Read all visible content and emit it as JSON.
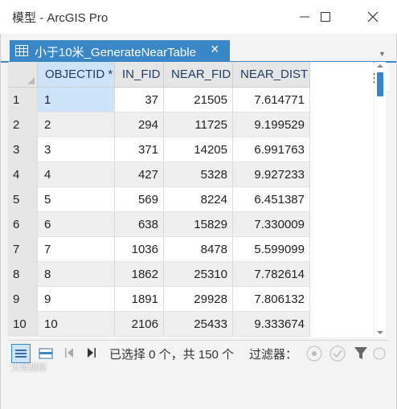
{
  "window": {
    "title": "模型 - ArcGIS Pro"
  },
  "tab": {
    "label": "小于10米_GenerateNearTable"
  },
  "table": {
    "columns": [
      "OBJECTID *",
      "IN_FID",
      "NEAR_FID",
      "NEAR_DIST"
    ],
    "rows": [
      [
        "1",
        "1",
        "37",
        "21505",
        "7.614771"
      ],
      [
        "2",
        "2",
        "294",
        "11725",
        "9.199529"
      ],
      [
        "3",
        "3",
        "371",
        "14205",
        "6.991763"
      ],
      [
        "4",
        "4",
        "427",
        "5328",
        "9.927233"
      ],
      [
        "5",
        "5",
        "569",
        "8224",
        "6.451387"
      ],
      [
        "6",
        "6",
        "638",
        "15829",
        "7.330009"
      ],
      [
        "7",
        "7",
        "1036",
        "8478",
        "5.599099"
      ],
      [
        "8",
        "8",
        "1862",
        "25310",
        "7.782614"
      ],
      [
        "9",
        "9",
        "1891",
        "29928",
        "7.806132"
      ],
      [
        "10",
        "10",
        "2106",
        "25433",
        "9.333674"
      ]
    ]
  },
  "status": {
    "selection": "已选择 0 个，共 150 个",
    "filter_label": "过滤器："
  },
  "colors": {
    "accent": "#3a87c8",
    "header_bg": "#e6e6e6",
    "selected": "#cde3f7"
  },
  "icons": [
    "table-icon",
    "close-icon",
    "minimize-icon",
    "maximize-icon",
    "hamburger-menu-icon",
    "first-record-icon",
    "last-record-icon",
    "filter-icon"
  ],
  "watermark": "大地测绘"
}
